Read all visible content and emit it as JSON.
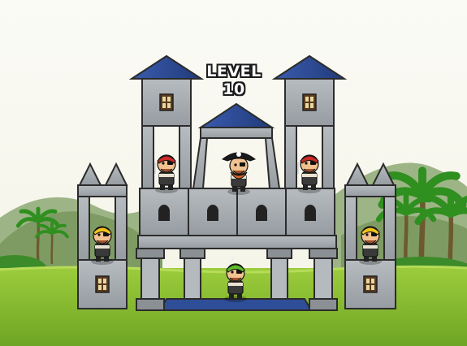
{
  "hud": {
    "level_label": "LEVEL 10"
  },
  "palette": {
    "sky": "#fbfbf6",
    "stone": "#a9afb3",
    "stone_dark": "#7d8388",
    "roof_blue": "#2e4d98",
    "grass": "#86bd2e",
    "hills": "#7e9b64"
  },
  "characters": [
    {
      "role": "captain",
      "icon": "pirate-captain-icon"
    },
    {
      "role": "pirate",
      "icon": "pirate-red-bandana-icon"
    },
    {
      "role": "pirate",
      "icon": "pirate-red-bandana-icon"
    },
    {
      "role": "pirate",
      "icon": "pirate-yellow-bandana-icon"
    },
    {
      "role": "pirate",
      "icon": "pirate-yellow-bandana-icon"
    },
    {
      "role": "pirate",
      "icon": "pirate-green-bandana-icon"
    }
  ]
}
